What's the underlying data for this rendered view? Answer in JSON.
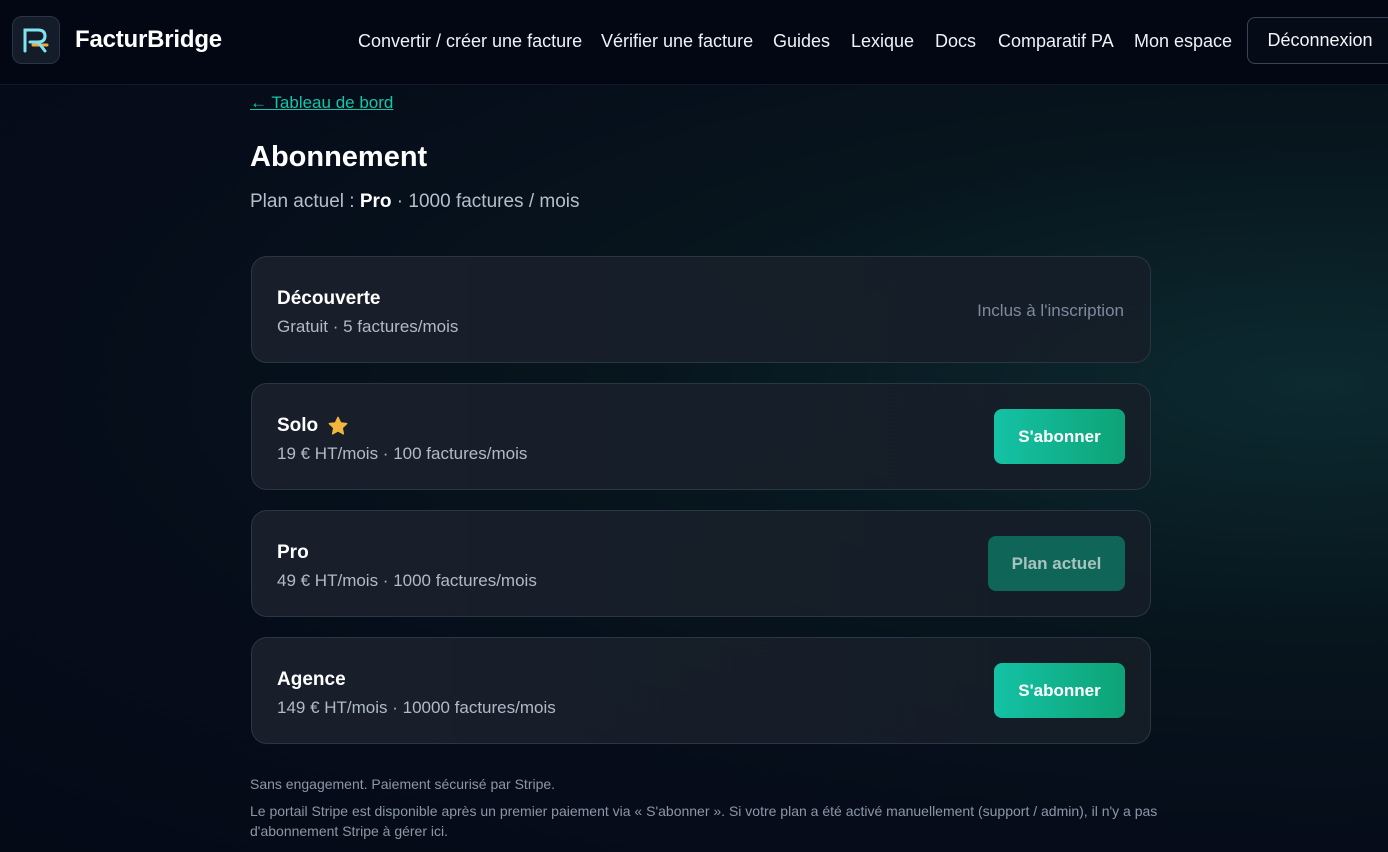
{
  "header": {
    "brand": "FacturBridge",
    "nav": [
      {
        "label": "Convertir / créer une facture"
      },
      {
        "label": "Vérifier une facture"
      },
      {
        "label": "Guides"
      },
      {
        "label": "Lexique"
      },
      {
        "label": "Docs"
      },
      {
        "label": "Comparatif PA"
      },
      {
        "label": "Mon espace"
      }
    ],
    "logout": "Déconnexion"
  },
  "page": {
    "back_link": "← Tableau de bord",
    "title": "Abonnement",
    "current_plan_prefix": "Plan actuel : ",
    "current_plan_name": "Pro",
    "current_plan_suffix": " · 1000 factures / mois"
  },
  "plans": [
    {
      "name": "Découverte",
      "desc": "Gratuit · 5 factures/mois",
      "note": "Inclus à l'inscription"
    },
    {
      "name": "Solo",
      "desc": "19 € HT/mois · 100 factures/mois",
      "button": "S'abonner",
      "icon": "star-icon"
    },
    {
      "name": "Pro",
      "desc": "49 € HT/mois · 1000 factures/mois",
      "button": "Plan actuel"
    },
    {
      "name": "Agence",
      "desc": "149 € HT/mois · 10000 factures/mois",
      "button": "S'abonner"
    }
  ],
  "footer": {
    "line1": "Sans engagement. Paiement sécurisé par Stripe.",
    "line2": "Le portail Stripe est disponible après un premier paiement via « S'abonner ». Si votre plan a été activé manuellement (support / admin), il n'y a pas d'abonnement Stripe à gérer ici."
  },
  "colors": {
    "accent": "#14c6a6",
    "button_gradient_start": "#14c2a5",
    "button_gradient_end": "#0ea376",
    "current_plan_button": "#0f6558",
    "star": "#f2b63c"
  }
}
